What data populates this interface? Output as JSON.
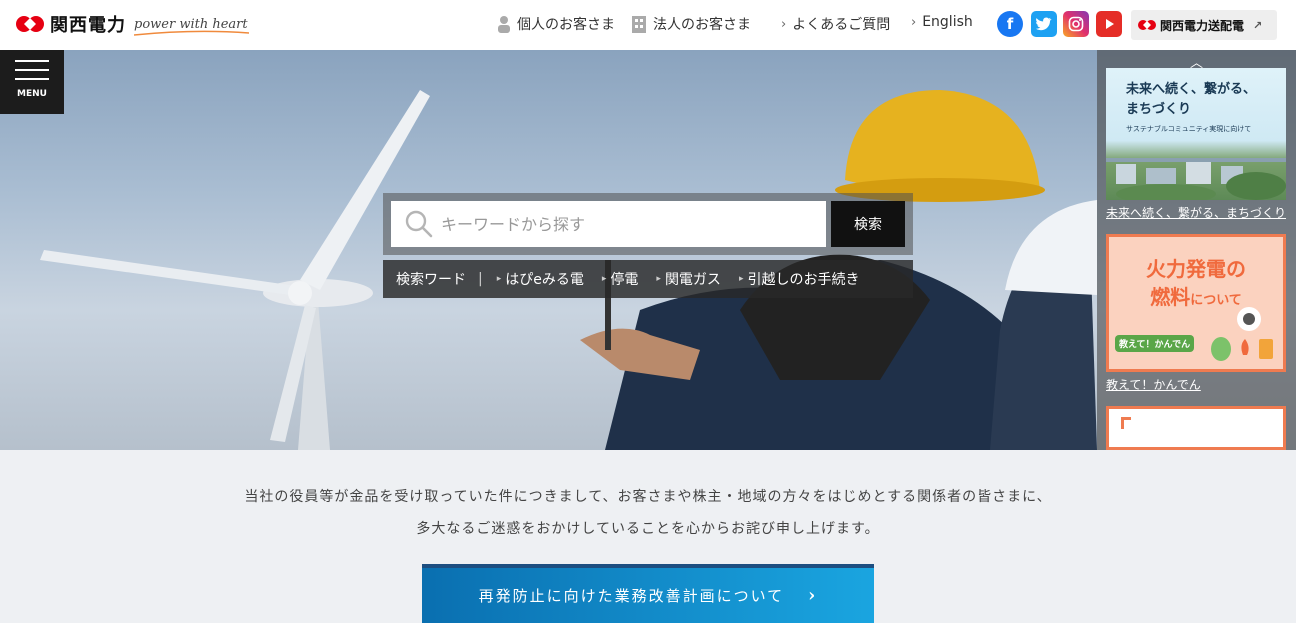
{
  "header": {
    "logo_text": "関西電力",
    "logo_tagline": "power with heart",
    "nav": [
      {
        "label": "個人のお客さま",
        "icon": "person-icon"
      },
      {
        "label": "法人のお客さま",
        "icon": "building-icon"
      },
      {
        "label": "よくあるご質問",
        "icon": "chevron-right-icon"
      },
      {
        "label": "English",
        "icon": "chevron-right-icon"
      }
    ],
    "social": [
      {
        "name": "facebook-icon",
        "glyph": "f",
        "color": "#1877f2"
      },
      {
        "name": "twitter-icon",
        "glyph": "t",
        "color": "#1da1f2"
      },
      {
        "name": "instagram-icon",
        "glyph": "◎",
        "color": "#c13584"
      },
      {
        "name": "youtube-icon",
        "glyph": "▶",
        "color": "#e52d27"
      }
    ],
    "transmission_link": "関西電力送配電"
  },
  "menu": {
    "label": "MENU"
  },
  "search": {
    "placeholder": "キーワードから探す",
    "button": "検索",
    "keywords_title": "検索ワード",
    "keywords_sep": "|",
    "keywords": [
      "はぴeみる電",
      "停電",
      "関電ガス",
      "引越しのお手続き"
    ]
  },
  "side_banners": [
    {
      "title_line1": "未来へ続く、繋がる、",
      "title_line2": "まちづくり",
      "subtitle": "サステナブルコミュニティ実現に向けて",
      "caption": "未来へ続く、繋がる、まちづくり"
    },
    {
      "title_line1": "火力発電の",
      "title_line2": "燃料",
      "title_suffix": "について",
      "badge": "教えて！かんでん",
      "caption": "教えて！かんでん"
    }
  ],
  "notice": {
    "line1": "当社の役員等が金品を受け取っていた件につきまして、お客さまや株主・地域の方々をはじめとする関係者の皆さまに、",
    "line2": "多大なるご迷惑をおかけしていることを心からお詫び申し上げます。",
    "plan_button": "再発防止に向けた業務改善計画について"
  },
  "colors": {
    "brand_red": "#e60012",
    "accent_orange": "#ef7b50",
    "button_blue": "#1aa5e0"
  }
}
